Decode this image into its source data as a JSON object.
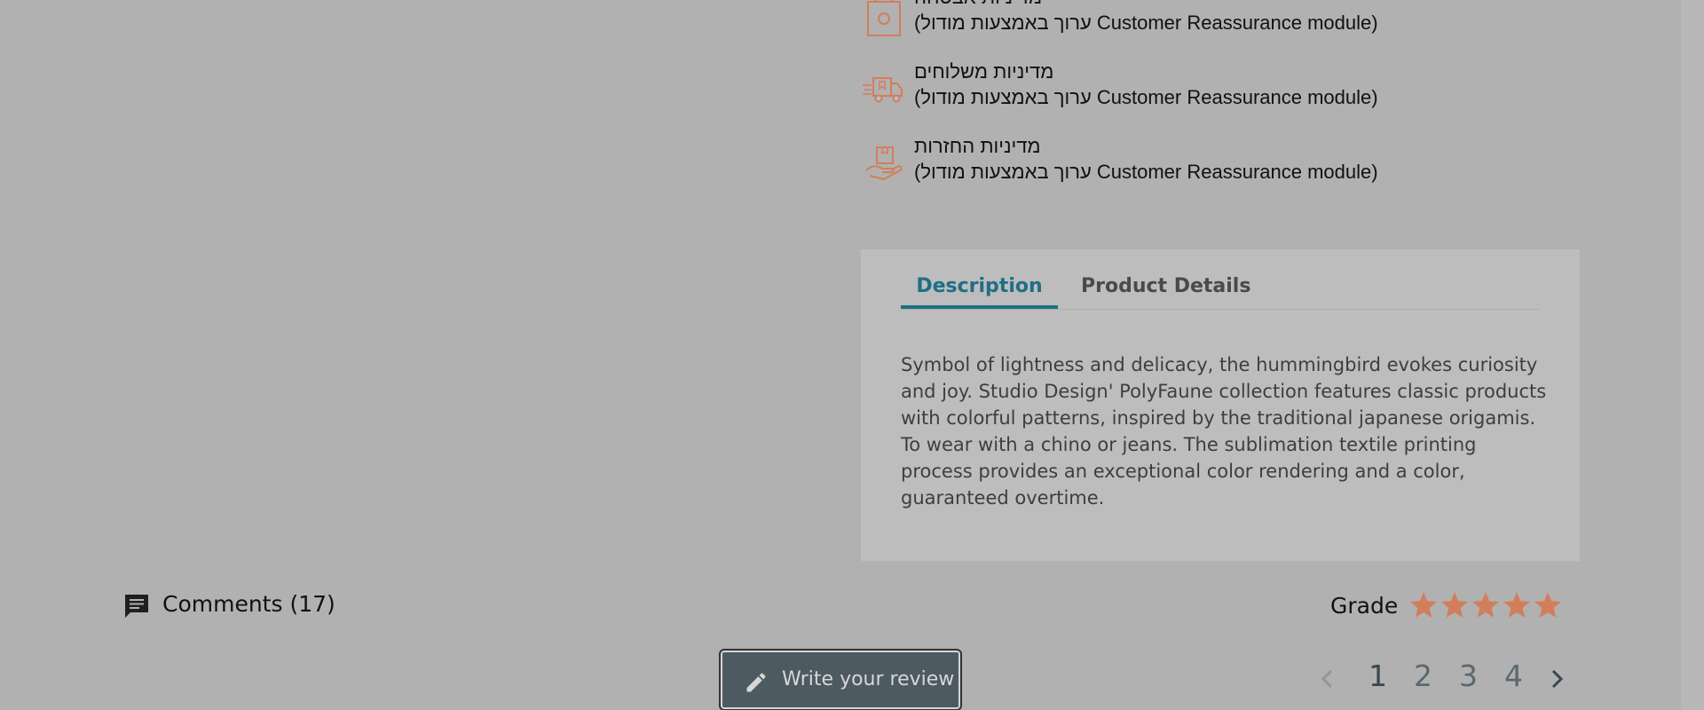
{
  "reassurance": {
    "items": [
      {
        "icon": "security-lock-icon",
        "title": "מדיניות אבטחה",
        "subtitle": "(ערוך באמצעות מודול Customer Reassurance module)"
      },
      {
        "icon": "delivery-truck-icon",
        "title": "מדיניות משלוחים",
        "subtitle": "(ערוך באמצעות מודול Customer Reassurance module)"
      },
      {
        "icon": "return-package-icon",
        "title": "מדיניות החזרות",
        "subtitle": "(ערוך באמצעות מודול Customer Reassurance module)"
      }
    ],
    "icon_color": "#d27e5b"
  },
  "tabs": {
    "items": [
      {
        "label": "Description",
        "active": true
      },
      {
        "label": "Product Details",
        "active": false
      }
    ],
    "description_text": "Symbol of lightness and delicacy, the hummingbird evokes curiosity and joy. Studio Design' PolyFaune collection features classic products with colorful patterns, inspired by the traditional japanese origamis. To wear with a chino or jeans. The sublimation textile printing process provides an exceptional color rendering and a color, guaranteed overtime.",
    "accent_color": "#1f6e86"
  },
  "comments": {
    "label": "Comments (17)",
    "icon": "comment-icon"
  },
  "grade": {
    "label": "Grade",
    "stars_filled": 5,
    "stars_total": 5,
    "star_color": "#d27e5b"
  },
  "review_button": {
    "label": "Write your review",
    "icon": "pencil-icon"
  },
  "pagination": {
    "pages": [
      "1",
      "2",
      "3",
      "4"
    ],
    "current": "1",
    "prev_icon": "chevron-left-icon",
    "next_icon": "chevron-right-icon"
  }
}
